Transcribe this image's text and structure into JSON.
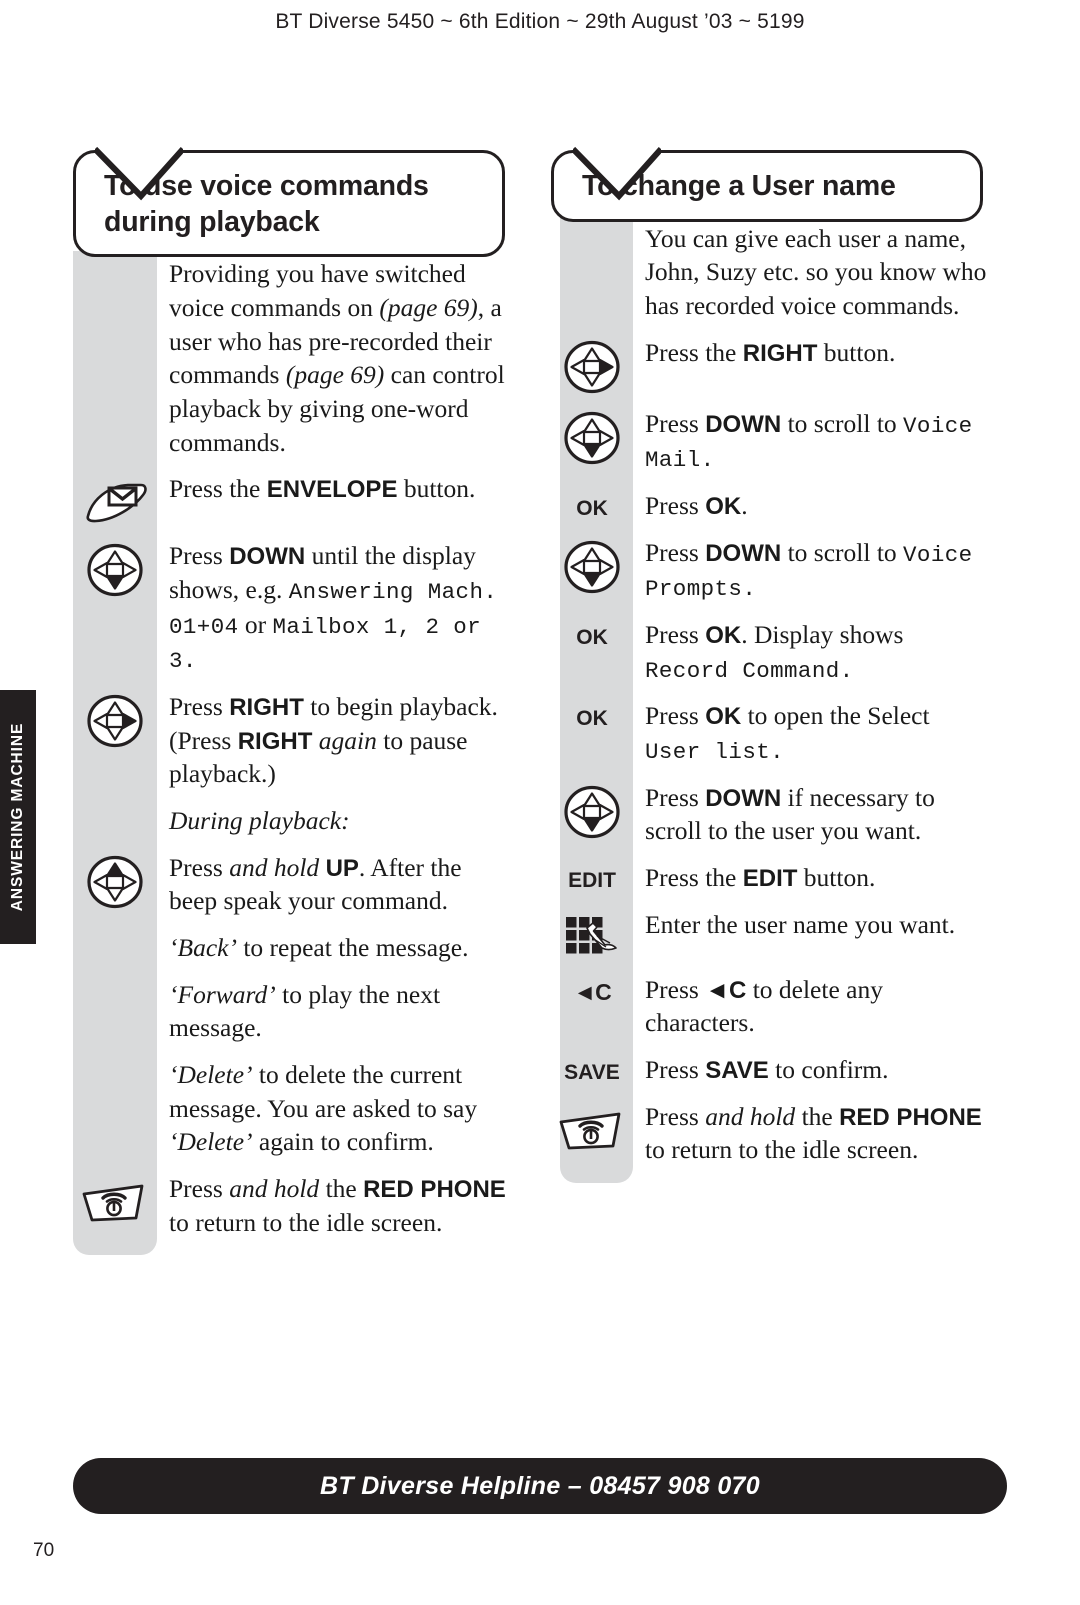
{
  "running_head": "BT Diverse 5450 ~ 6th Edition ~ 29th August ’03 ~ 5199",
  "side_tab": "ANSWERING MACHINE",
  "page_number": "70",
  "footer": "BT Diverse Helpline – 08457 908 070",
  "colors": {
    "ink": "#231f20",
    "spine_grey": "#d9dadb",
    "bar_black": "#231f20",
    "paper": "#ffffff"
  },
  "left_column": {
    "title": "To use voice commands during playback",
    "steps": [
      {
        "icon": "none",
        "icon_label": "",
        "parts": [
          {
            "t": "Providing you have switched voice commands on ",
            "s": "roman"
          },
          {
            "t": "(page 69)",
            "s": "italic"
          },
          {
            "t": ", a user who has pre-recorded their commands ",
            "s": "roman"
          },
          {
            "t": "(page 69)",
            "s": "italic"
          },
          {
            "t": " can control playback by giving one-word commands.",
            "s": "roman"
          }
        ]
      },
      {
        "icon": "envelope-button",
        "icon_label": "",
        "parts": [
          {
            "t": "Press the ",
            "s": "roman"
          },
          {
            "t": "ENVELOPE",
            "s": "bold"
          },
          {
            "t": " button.",
            "s": "roman"
          }
        ]
      },
      {
        "icon": "dpad-down",
        "icon_label": "",
        "parts": [
          {
            "t": "Press ",
            "s": "roman"
          },
          {
            "t": "DOWN",
            "s": "bold"
          },
          {
            "t": " until the display shows, e.g. ",
            "s": "roman"
          },
          {
            "t": "Answering Mach. 01+04",
            "s": "lcd"
          },
          {
            "t": " or ",
            "s": "roman"
          },
          {
            "t": "Mailbox 1, 2 or 3.",
            "s": "lcd"
          }
        ]
      },
      {
        "icon": "dpad-right",
        "icon_label": "",
        "parts": [
          {
            "t": "Press ",
            "s": "roman"
          },
          {
            "t": "RIGHT",
            "s": "bold"
          },
          {
            "t": " to begin playback. (Press ",
            "s": "roman"
          },
          {
            "t": "RIGHT",
            "s": "bold"
          },
          {
            "t": " ",
            "s": "roman"
          },
          {
            "t": "again",
            "s": "italic"
          },
          {
            "t": " to pause playback.)",
            "s": "roman"
          }
        ]
      },
      {
        "icon": "none",
        "icon_label": "",
        "parts": [
          {
            "t": "During playback:",
            "s": "italic"
          }
        ]
      },
      {
        "icon": "dpad-up",
        "icon_label": "",
        "parts": [
          {
            "t": "Press ",
            "s": "roman"
          },
          {
            "t": "and hold",
            "s": "italic"
          },
          {
            "t": " ",
            "s": "roman"
          },
          {
            "t": "UP",
            "s": "bold"
          },
          {
            "t": ". After the beep speak your command.",
            "s": "roman"
          }
        ]
      },
      {
        "icon": "none",
        "icon_label": "",
        "parts": [
          {
            "t": "‘Back’",
            "s": "italic"
          },
          {
            "t": " to repeat the message.",
            "s": "roman"
          }
        ]
      },
      {
        "icon": "none",
        "icon_label": "",
        "parts": [
          {
            "t": "‘Forward’",
            "s": "italic"
          },
          {
            "t": " to play the next message.",
            "s": "roman"
          }
        ]
      },
      {
        "icon": "none",
        "icon_label": "",
        "parts": [
          {
            "t": "‘Delete’",
            "s": "italic"
          },
          {
            "t": " to delete the current message. You are asked to say ",
            "s": "roman"
          },
          {
            "t": "‘Delete’",
            "s": "italic"
          },
          {
            "t": " again to confirm.",
            "s": "roman"
          }
        ]
      },
      {
        "icon": "red-phone-button",
        "icon_label": "",
        "parts": [
          {
            "t": "Press ",
            "s": "roman"
          },
          {
            "t": "and hold",
            "s": "italic"
          },
          {
            "t": " the ",
            "s": "roman"
          },
          {
            "t": "RED PHONE",
            "s": "bold"
          },
          {
            "t": " to return to the idle screen.",
            "s": "roman"
          }
        ]
      }
    ]
  },
  "right_column": {
    "title": "To change a User name",
    "steps": [
      {
        "icon": "none",
        "icon_label": "",
        "parts": [
          {
            "t": "You can give each user a name, John, Suzy etc. so you know who has recorded voice commands.",
            "s": "roman"
          }
        ]
      },
      {
        "icon": "dpad-right",
        "icon_label": "",
        "parts": [
          {
            "t": "Press the ",
            "s": "roman"
          },
          {
            "t": "RIGHT",
            "s": "bold"
          },
          {
            "t": " button.",
            "s": "roman"
          }
        ]
      },
      {
        "icon": "dpad-down",
        "icon_label": "",
        "parts": [
          {
            "t": "Press ",
            "s": "roman"
          },
          {
            "t": "DOWN",
            "s": "bold"
          },
          {
            "t": " to scroll to ",
            "s": "roman"
          },
          {
            "t": "Voice Mail.",
            "s": "lcd"
          }
        ]
      },
      {
        "icon": "text",
        "icon_label": "OK",
        "parts": [
          {
            "t": "Press ",
            "s": "roman"
          },
          {
            "t": "OK",
            "s": "bold"
          },
          {
            "t": ".",
            "s": "roman"
          }
        ]
      },
      {
        "icon": "dpad-down",
        "icon_label": "",
        "parts": [
          {
            "t": "Press ",
            "s": "roman"
          },
          {
            "t": "DOWN",
            "s": "bold"
          },
          {
            "t": " to scroll to ",
            "s": "roman"
          },
          {
            "t": "Voice Prompts.",
            "s": "lcd"
          }
        ]
      },
      {
        "icon": "text",
        "icon_label": "OK",
        "parts": [
          {
            "t": "Press ",
            "s": "roman"
          },
          {
            "t": "OK",
            "s": "bold"
          },
          {
            "t": ". Display shows ",
            "s": "roman"
          },
          {
            "t": "Record Command.",
            "s": "lcd"
          }
        ]
      },
      {
        "icon": "text",
        "icon_label": "OK",
        "parts": [
          {
            "t": "Press ",
            "s": "roman"
          },
          {
            "t": "OK",
            "s": "bold"
          },
          {
            "t": " to open the Select ",
            "s": "roman"
          },
          {
            "t": "User list.",
            "s": "lcd"
          }
        ]
      },
      {
        "icon": "dpad-down",
        "icon_label": "",
        "parts": [
          {
            "t": "Press ",
            "s": "roman"
          },
          {
            "t": "DOWN",
            "s": "bold"
          },
          {
            "t": " if necessary to scroll to the user you want.",
            "s": "roman"
          }
        ]
      },
      {
        "icon": "text",
        "icon_label": "EDIT",
        "parts": [
          {
            "t": "Press the ",
            "s": "roman"
          },
          {
            "t": "EDIT",
            "s": "bold"
          },
          {
            "t": " button.",
            "s": "roman"
          }
        ]
      },
      {
        "icon": "keypad-hand",
        "icon_label": "",
        "parts": [
          {
            "t": "Enter the user name you want.",
            "s": "roman"
          }
        ]
      },
      {
        "icon": "text-backc",
        "icon_label": "◄C",
        "parts": [
          {
            "t": "Press ",
            "s": "roman"
          },
          {
            "t": "◄C",
            "s": "bold"
          },
          {
            "t": " to delete any characters.",
            "s": "roman"
          }
        ]
      },
      {
        "icon": "text",
        "icon_label": "SAVE",
        "parts": [
          {
            "t": "Press ",
            "s": "roman"
          },
          {
            "t": "SAVE",
            "s": "bold"
          },
          {
            "t": " to confirm.",
            "s": "roman"
          }
        ]
      },
      {
        "icon": "red-phone-button",
        "icon_label": "",
        "parts": [
          {
            "t": "Press ",
            "s": "roman"
          },
          {
            "t": "and hold",
            "s": "italic"
          },
          {
            "t": " the ",
            "s": "roman"
          },
          {
            "t": "RED PHONE",
            "s": "bold"
          },
          {
            "t": " to return to the idle screen.",
            "s": "roman"
          }
        ]
      }
    ]
  }
}
